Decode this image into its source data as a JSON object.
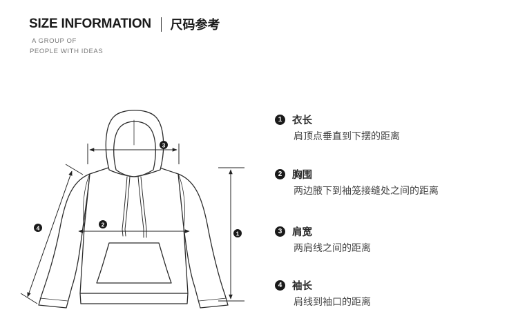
{
  "header": {
    "title_en": "SIZE INFORMATION",
    "title_cn": "尺码参考",
    "subtitle_line1": "A GROUP OF",
    "subtitle_line2": "PEOPLE WITH IDEAS"
  },
  "legend": {
    "items": [
      {
        "num": "1",
        "title": "衣长",
        "desc": "肩顶点垂直到下摆的距离"
      },
      {
        "num": "2",
        "title": "胸围",
        "desc": "两边腋下到袖笼接缝处之间的距离"
      },
      {
        "num": "3",
        "title": "肩宽",
        "desc": "两肩线之间的距离"
      },
      {
        "num": "4",
        "title": "袖长",
        "desc": "肩线到袖口的距离"
      }
    ]
  },
  "diagram_markers": [
    "1",
    "2",
    "3",
    "4"
  ]
}
